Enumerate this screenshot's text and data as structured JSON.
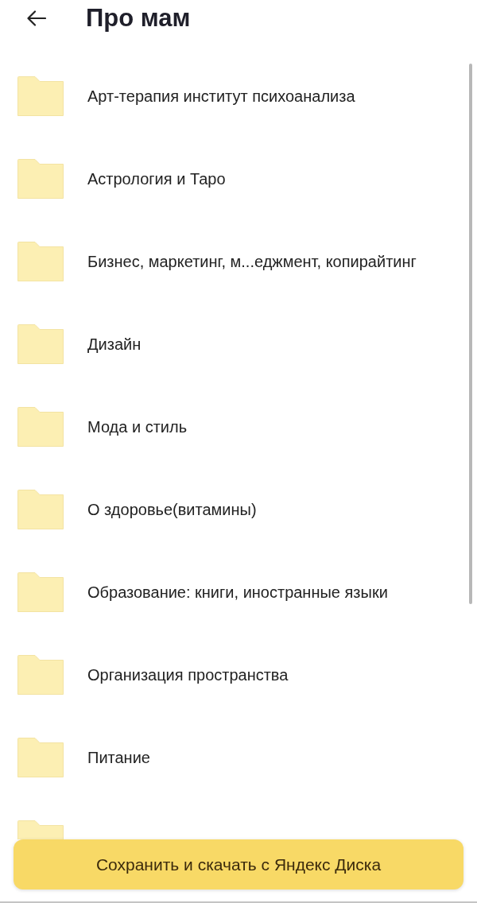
{
  "header": {
    "title": "Про мам"
  },
  "folders": [
    {
      "kind": "folder",
      "name": "Арт-терапия институт психоанализа"
    },
    {
      "kind": "folder",
      "name": "Астрология и Таро"
    },
    {
      "kind": "folder",
      "name": "Бизнес, маркетинг, м...еджмент, копирайтинг"
    },
    {
      "kind": "folder",
      "name": "Дизайн"
    },
    {
      "kind": "folder",
      "name": "Мода и стиль"
    },
    {
      "kind": "folder",
      "name": "О здоровье(витамины)"
    },
    {
      "kind": "folder",
      "name": "Образование: книги, иностранные языки"
    },
    {
      "kind": "folder",
      "name": "Организация пространства"
    },
    {
      "kind": "folder",
      "name": "Питание"
    },
    {
      "kind": "folder"
    }
  ],
  "save_button": {
    "label": "Сохранить и скачать с Яндекс Диска"
  }
}
